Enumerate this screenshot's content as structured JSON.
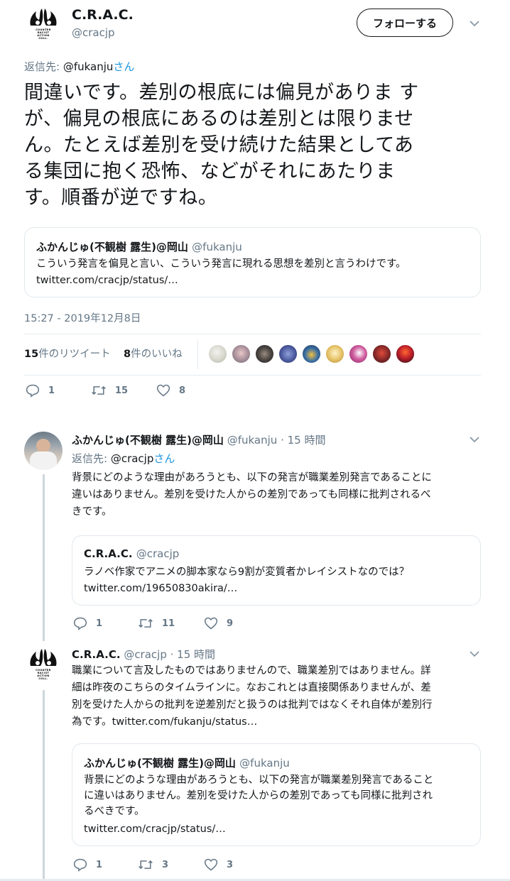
{
  "main_tweet": {
    "display_name": "C.R.A.C.",
    "handle": "@cracjp",
    "follow_label": "フォローする",
    "reply_to_prefix": "返信先: ",
    "reply_to_handle": "@fukanju",
    "reply_to_suffix": "さん",
    "text_lines": [
      "間違いです。差別の根底には偏見がありま す",
      "が、偏見の根底にあるのは差別とは限りませ",
      "ん。たとえば差別を受け続けた結果としてあ",
      "る集団に抱く恐怖、などがそれにあたりま",
      "す。順番が逆ですね。"
    ],
    "quote": {
      "name": "ふかんじゅ(不観樹 露生)@岡山",
      "handle": "@fukanju",
      "text": "こういう発言を偏見と言い、こういう発言に現れる思想を差別と言うわけです。",
      "link": "twitter.com/cracjp/status/…"
    },
    "timestamp": "15:27 - 2019年12月8日",
    "retweets_count": "15",
    "retweets_label": "件のリツイート",
    "likes_count": "8",
    "likes_label": "件のいいね",
    "actions": {
      "reply": "1",
      "retweet": "15",
      "like": "8"
    }
  },
  "reply1": {
    "display_name": "ふかんじゅ(不観樹 露生)@岡山",
    "handle": "@fukanju",
    "time": "· 15 時間",
    "reply_to_prefix": "返信先: ",
    "reply_to_handle": "@cracjp",
    "reply_to_suffix": "さん",
    "text_lines": [
      "背景にどのような理由があろうとも、以下の発言が職業差別発言であることに",
      "違いはありません。差別を受けた人からの差別であっても同様に批判されるべ",
      "きです。"
    ],
    "quote": {
      "name": "C.R.A.C.",
      "handle": "@cracjp",
      "text": "ラノベ作家でアニメの脚本家なら9割が変質者かレイシストなのでは？",
      "link": "twitter.com/19650830akira/…"
    },
    "actions": {
      "reply": "1",
      "retweet": "11",
      "like": "9"
    }
  },
  "reply2": {
    "display_name": "C.R.A.C.",
    "handle": "@cracjp",
    "time": "· 15 時間",
    "text_lines": [
      "職業について言及したものではありませんので、職業差別ではありません。詳",
      "細は昨夜のこちらのタイムラインに。なおこれとは直接関係ありませんが、差",
      "別を受けた人からの批判を逆差別だと扱うのは批判ではなくそれ自体が差別行"
    ],
    "text_last_plain": "為です。",
    "text_last_link": "twitter.com/fukanju/status…",
    "quote": {
      "name": "ふかんじゅ(不観樹 露生)@岡山",
      "handle": "@fukanju",
      "text_lines": [
        "背景にどのような理由があろうとも、以下の発言が職業差別発言であること",
        "に違いはありません。差別を受けた人からの差別であっても同様に批判され",
        "るべきです。"
      ],
      "link": "twitter.com/cracjp/status/…"
    },
    "actions": {
      "reply": "1",
      "retweet": "3",
      "like": "3"
    }
  },
  "colors": {
    "link": "#1b95e0",
    "secondary_text": "#657786",
    "border": "#e1e8ed",
    "thread_line": "#ccd6dd"
  }
}
